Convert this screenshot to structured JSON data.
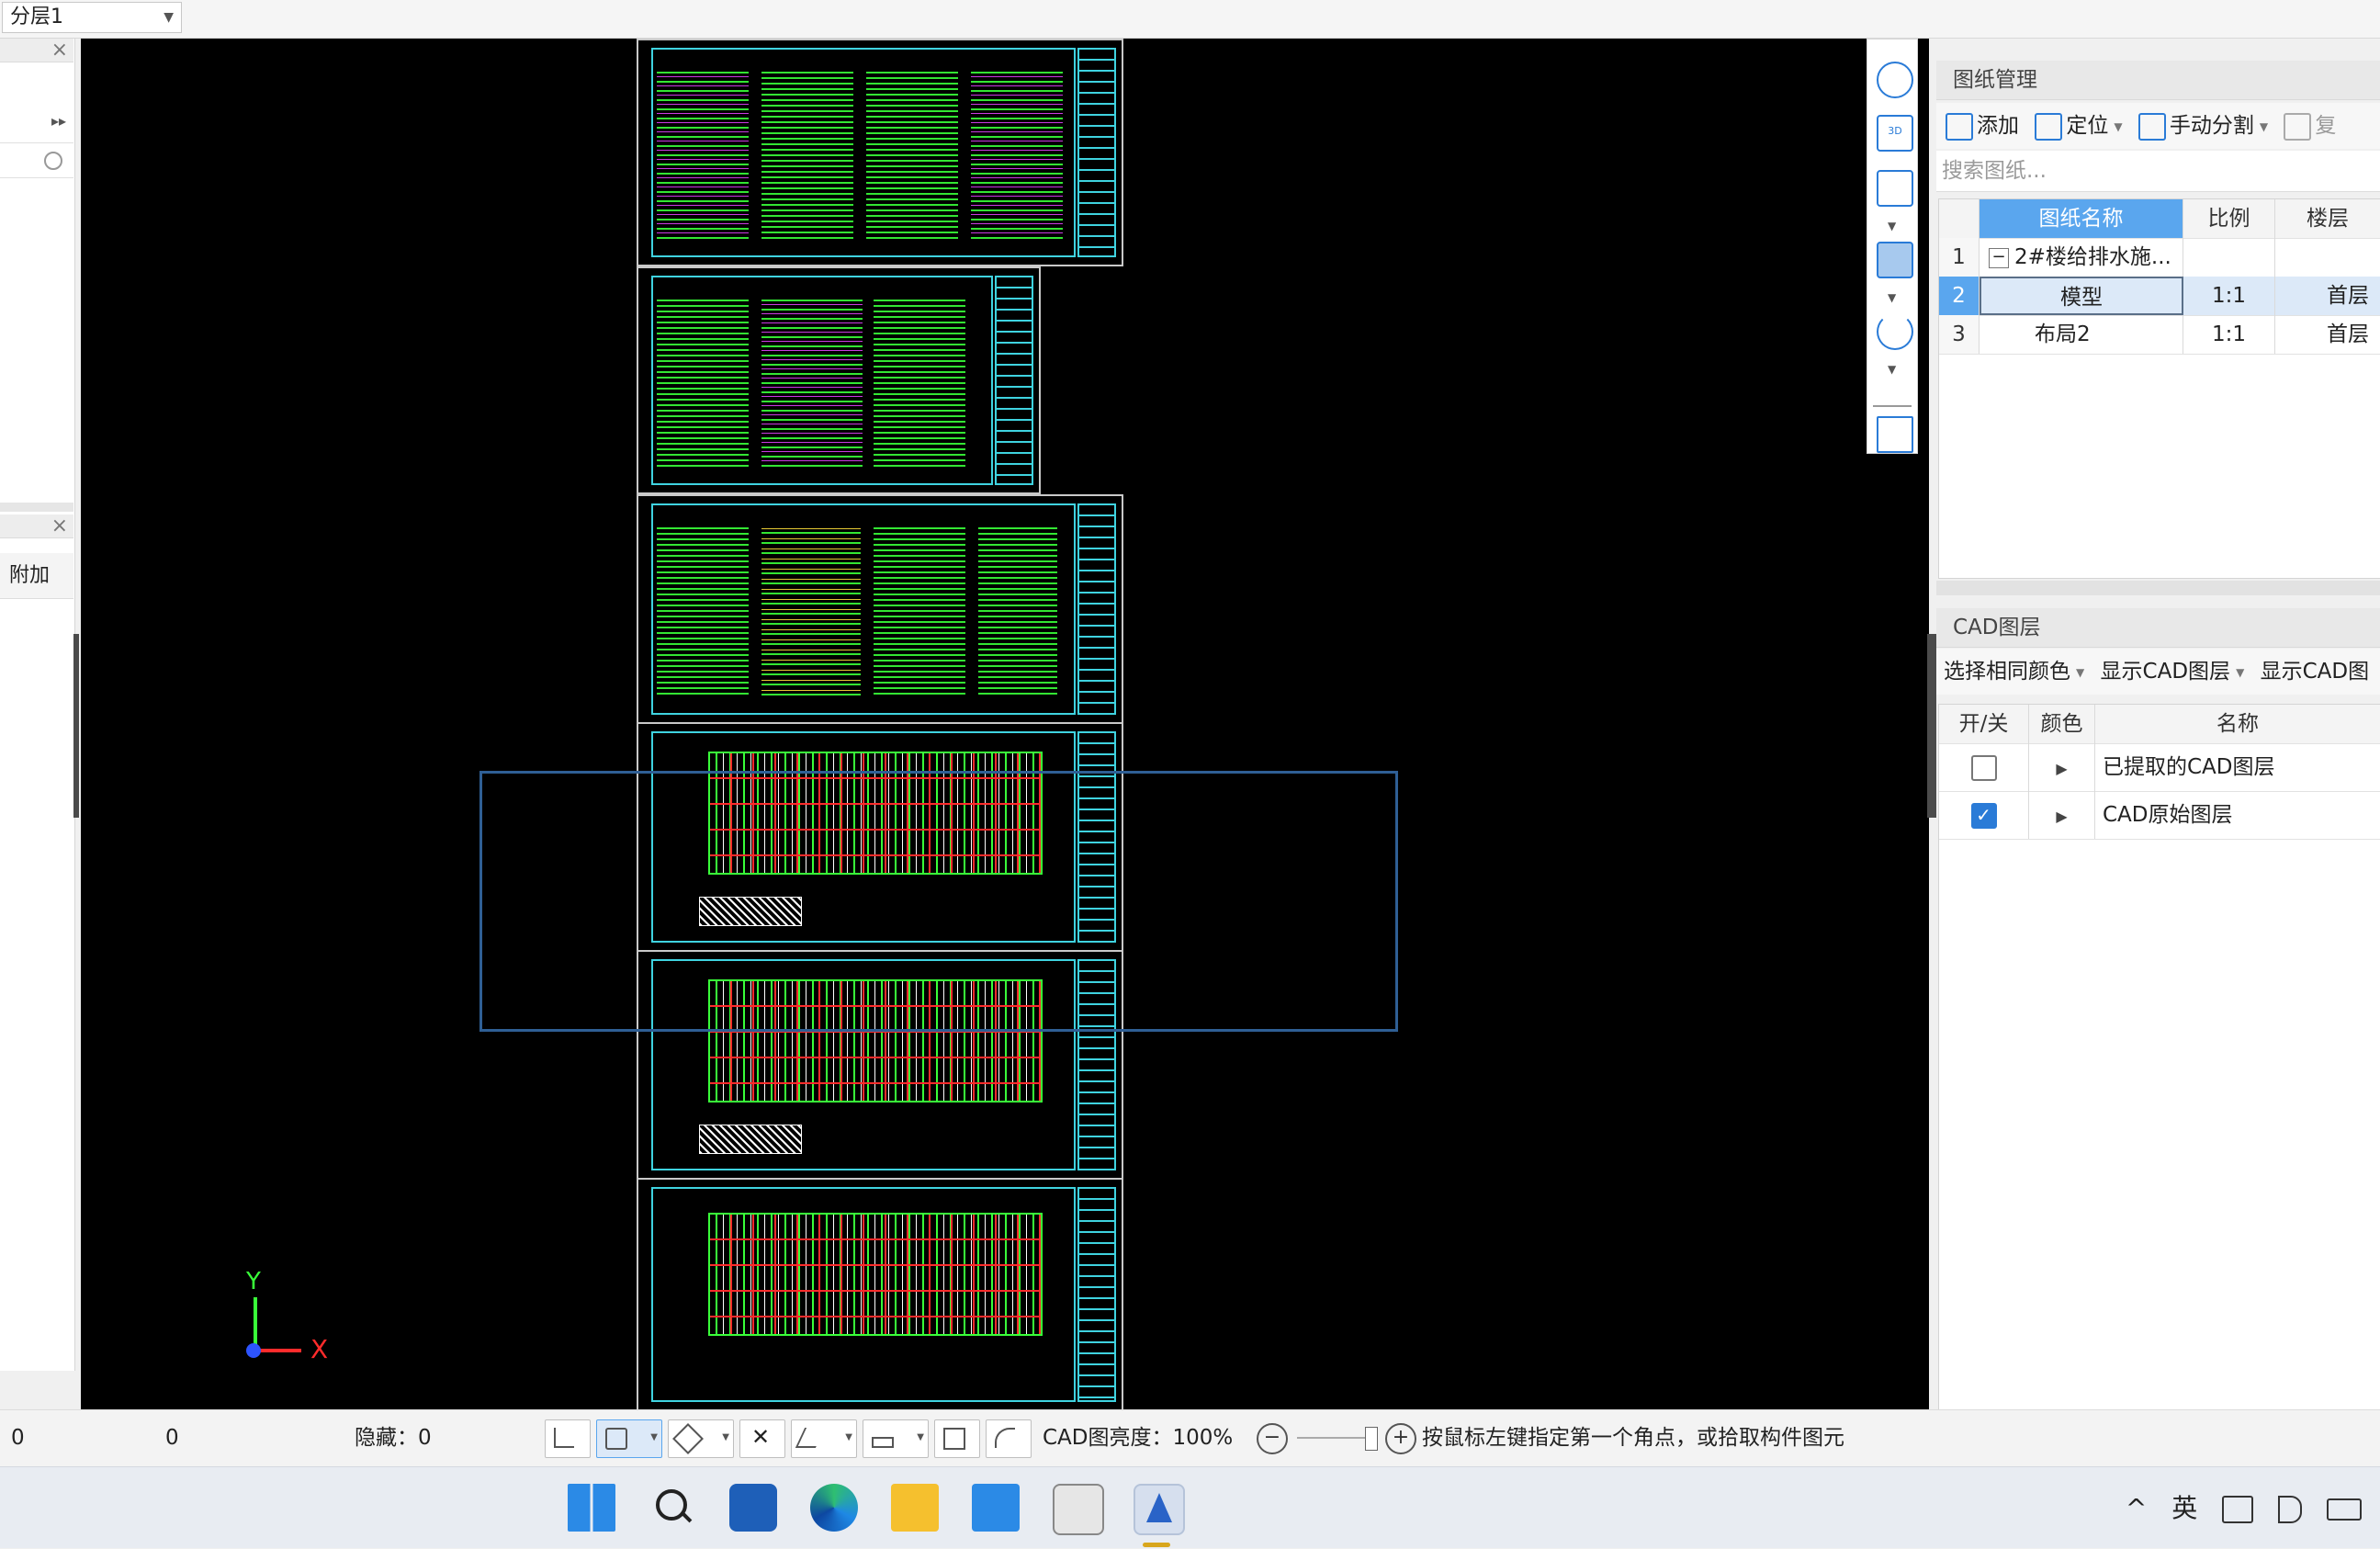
{
  "topbar": {
    "layer_select": "分层1"
  },
  "left_panel": {
    "addon_label": "附加"
  },
  "canvas": {
    "axis_x": "X",
    "axis_y": "Y"
  },
  "drawing_panel": {
    "title": "图纸管理",
    "toolbar": {
      "add": "添加",
      "locate": "定位",
      "manual_split": "手动分割",
      "copy": "复"
    },
    "search_placeholder": "搜索图纸...",
    "columns": [
      "图纸名称",
      "比例",
      "楼层"
    ],
    "rows": [
      {
        "num": "1",
        "name": "2#楼给排水施...",
        "scale": "",
        "floor": ""
      },
      {
        "num": "2",
        "name": "模型",
        "scale": "1:1",
        "floor": "首层"
      },
      {
        "num": "3",
        "name": "布局2",
        "scale": "1:1",
        "floor": "首层"
      }
    ]
  },
  "cad_layer_panel": {
    "title": "CAD图层",
    "toolbar": {
      "select_same_color": "选择相同颜色",
      "show_cad_layer": "显示CAD图层",
      "show_cad_more": "显示CAD图"
    },
    "columns": [
      "开/关",
      "颜色",
      "名称"
    ],
    "rows": [
      {
        "checked": false,
        "name": "已提取的CAD图层"
      },
      {
        "checked": true,
        "name": "CAD原始图层"
      }
    ]
  },
  "statusbar": {
    "coord_x": "0",
    "coord_y": "0",
    "hidden": "隐藏：0",
    "brightness": "CAD图亮度：100%",
    "hint": "按鼠标左键指定第一个角点，或拾取构件图元"
  },
  "taskbar": {
    "ime": "英"
  },
  "colors": {
    "accent": "#2a7bd7",
    "canvas_bg": "#000000",
    "cad_green": "#39ff39",
    "cad_cyan": "#3fd3e0",
    "selection": "#2f5f95"
  }
}
